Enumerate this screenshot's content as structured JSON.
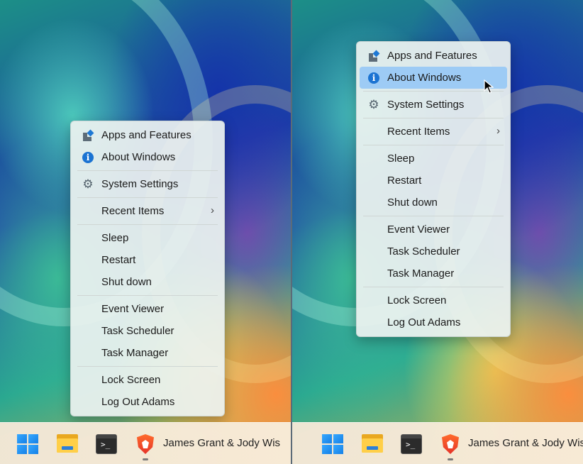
{
  "taskbar": {
    "window_title": "James Grant & Jody Wis",
    "icons": [
      "windows-start-icon",
      "file-explorer-icon",
      "terminal-icon",
      "brave-browser-icon"
    ],
    "terminal_prompt": ">_"
  },
  "menu": {
    "items": [
      {
        "label": "Apps and Features",
        "icon": "apps-features-icon"
      },
      {
        "label": "About Windows",
        "icon": "info-icon"
      },
      {
        "label": "System Settings",
        "icon": "gear-icon"
      },
      {
        "label": "Recent Items",
        "submenu": true
      },
      {
        "label": "Sleep"
      },
      {
        "label": "Restart"
      },
      {
        "label": "Shut down"
      },
      {
        "label": "Event Viewer"
      },
      {
        "label": "Task Scheduler"
      },
      {
        "label": "Task Manager"
      },
      {
        "label": "Lock Screen"
      },
      {
        "label": "Log Out Adams"
      }
    ],
    "chevron": "›",
    "highlighted_item_right_panel": "About Windows",
    "highlight_color": "#9dcbf5"
  }
}
